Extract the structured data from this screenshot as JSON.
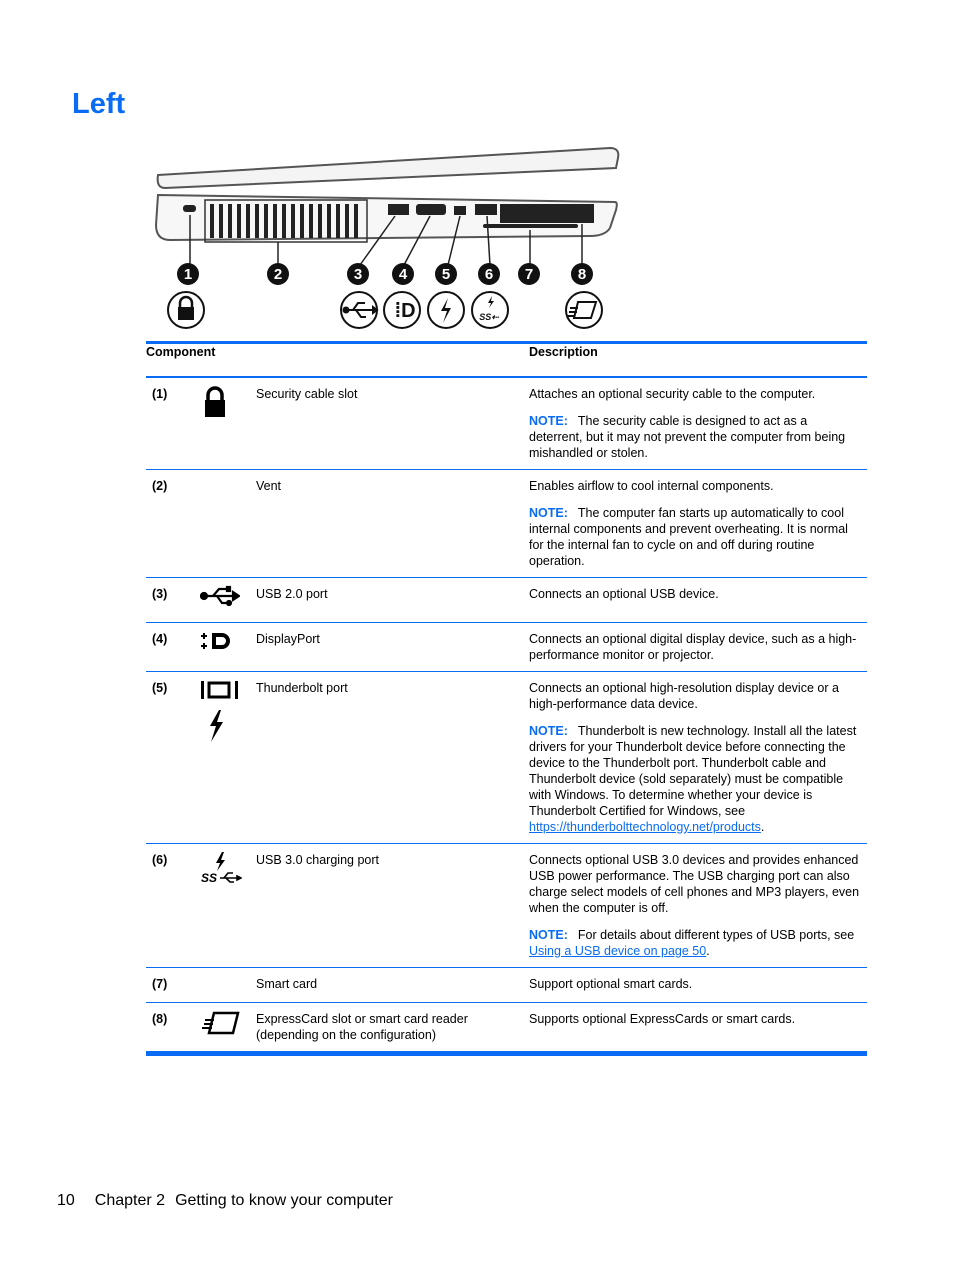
{
  "page": {
    "title": "Left",
    "footer": {
      "page_number": "10",
      "chapter": "Chapter 2",
      "chapter_title": "Getting to know your computer"
    }
  },
  "figure": {
    "callouts": [
      "1",
      "2",
      "3",
      "4",
      "5",
      "6",
      "7",
      "8"
    ],
    "icons": [
      "lock-icon",
      "usb-icon",
      "displayport-icon",
      "thunderbolt-icon",
      "usb3-charging-icon",
      "expresscard-icon"
    ]
  },
  "table": {
    "headers": {
      "component": "Component",
      "description": "Description"
    },
    "note_label": "NOTE:",
    "rows": [
      {
        "num": "(1)",
        "icon": "lock-icon",
        "name": "Security cable slot",
        "desc": "Attaches an optional security cable to the computer.",
        "note": "The security cable is designed to act as a deterrent, but it may not prevent the computer from being mishandled or stolen."
      },
      {
        "num": "(2)",
        "icon": "",
        "name": "Vent",
        "desc": "Enables airflow to cool internal components.",
        "note": "The computer fan starts up automatically to cool internal components and prevent overheating. It is normal for the internal fan to cycle on and off during routine operation."
      },
      {
        "num": "(3)",
        "icon": "usb-icon",
        "name": "USB 2.0 port",
        "desc": "Connects an optional USB device."
      },
      {
        "num": "(4)",
        "icon": "displayport-icon",
        "name": "DisplayPort",
        "desc": "Connects an optional digital display device, such as a high-performance monitor or projector."
      },
      {
        "num": "(5)",
        "icon": "thunderbolt-icon",
        "name": "Thunderbolt port",
        "desc": "Connects an optional high-resolution display device or a high-performance data device.",
        "note": "Thunderbolt is new technology. Install all the latest drivers for your Thunderbolt device before connecting the device to the Thunderbolt port. Thunderbolt cable and Thunderbolt device (sold separately) must be compatible with Windows. To determine whether your device is Thunderbolt Certified for Windows, see",
        "note_link": "https://thunderbolttechnology.net/products",
        "note_suffix": "."
      },
      {
        "num": "(6)",
        "icon": "usb3-charging-icon",
        "name": "USB 3.0 charging port",
        "desc": "Connects optional USB 3.0 devices and provides enhanced USB power performance. The USB charging port can also charge select models of cell phones and MP3 players, even when the computer is off.",
        "note": "For details about different types of USB ports, see",
        "note_link": "Using a USB device on page 50",
        "note_suffix": "."
      },
      {
        "num": "(7)",
        "icon": "",
        "name": "Smart card",
        "desc": "Support optional smart cards."
      },
      {
        "num": "(8)",
        "icon": "expresscard-icon",
        "name": "ExpressCard slot or smart card reader (depending on the configuration)",
        "desc": "Supports optional ExpressCards or smart cards."
      }
    ]
  }
}
